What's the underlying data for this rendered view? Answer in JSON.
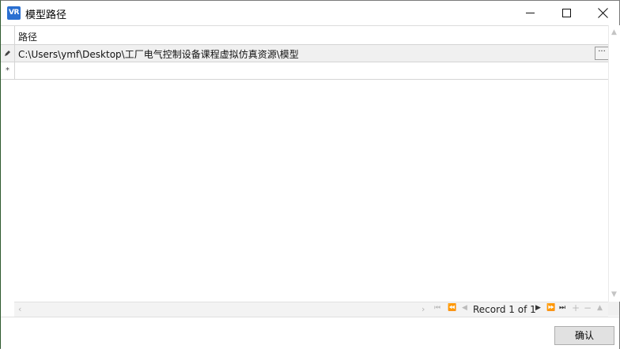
{
  "window": {
    "title": "模型路径",
    "app_icon_text": "VR",
    "accent": "#2a6fd1"
  },
  "grid": {
    "column_header": "路径",
    "rows": [
      {
        "indicator": "edit-pencil-icon",
        "value": "C:\\Users\\ymf\\Desktop\\工厂电气控制设备课程虚拟仿真资源\\模型"
      }
    ],
    "new_row_indicator": "*",
    "ellipsis_label": "···"
  },
  "navigator": {
    "record_text": "Record 1 of 1"
  },
  "footer": {
    "confirm_label": "确认"
  }
}
